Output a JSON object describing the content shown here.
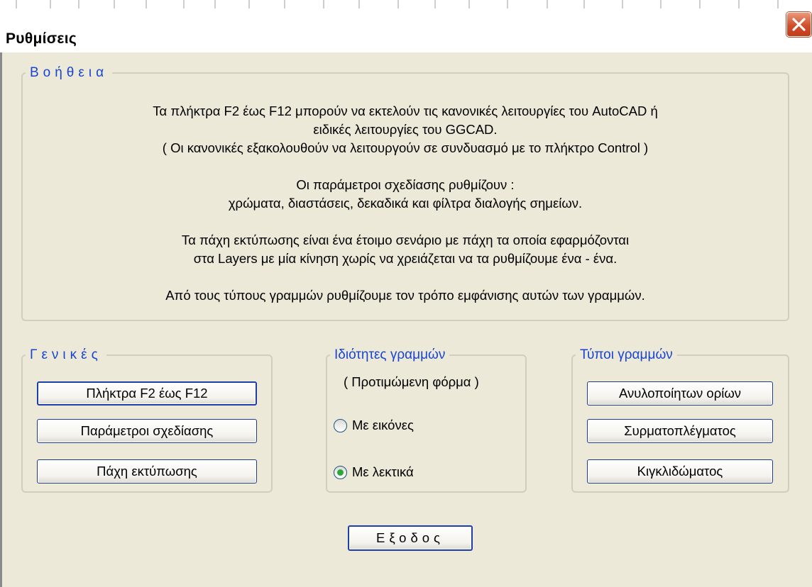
{
  "window": {
    "title": "Ρυθμίσεις",
    "close_label": "Close"
  },
  "help": {
    "legend": "Βοήθεια",
    "lines": [
      "Τα πλήκτρα F2 έως F12 μπορούν να εκτελούν τις κανονικές λειτουργίες του AutoCAD ή",
      "ειδικές λειτουργίες του GGCAD.",
      "( Οι κανονικές εξακολουθούν να λειτουργούν σε συνδυασμό με το πλήκτρο Control )",
      "Οι παράμετροι σχεδίασης ρυθμίζουν :",
      "χρώματα, διαστάσεις, δεκαδικά και φίλτρα διαλογής σημείων.",
      "Τα πάχη εκτύπωσης είναι ένα έτοιμο σενάριο με πάχη τα οποία εφαρμόζονται",
      "στα Layers με μία κίνηση χωρίς να χρειάζεται να τα ρυθμίζουμε ένα - ένα.",
      "Από τους τύπους γραμμών ρυθμίζουμε τον τρόπο εμφάνισης αυτών των γραμμών."
    ]
  },
  "general": {
    "legend": "Γενικές",
    "buttons": [
      "Πλήκτρα F2 έως F12",
      "Παράμετροι σχεδίασης",
      "Πάχη εκτύπωσης"
    ]
  },
  "line_properties": {
    "legend": "Ιδιότητες γραμμών",
    "subtitle": "( Προτιμώμενη φόρμα )",
    "options": [
      {
        "label": "Με εικόνες",
        "checked": false
      },
      {
        "label": "Με λεκτικά",
        "checked": true
      }
    ]
  },
  "line_types": {
    "legend": "Τύποι γραμμών",
    "buttons": [
      "Ανυλοποίητων ορίων",
      "Συρματοπλέγματος",
      "Κιγκλιδώματος"
    ]
  },
  "exit_button": "Εξοδος",
  "colors": {
    "legend_blue": "#1844d2",
    "close_red": "#d14f2b",
    "radio_green": "#2fa63b",
    "dialog_bg": "#ece9d8"
  }
}
